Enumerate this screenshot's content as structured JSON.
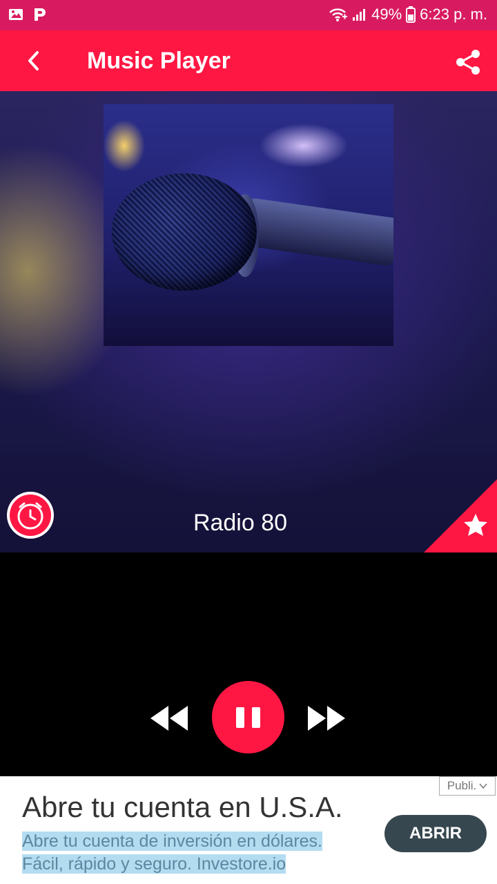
{
  "status_bar": {
    "battery": "49%",
    "time": "6:23 p. m."
  },
  "app_bar": {
    "title": "Music Player"
  },
  "player": {
    "station_name": "Radio 80"
  },
  "ad": {
    "badge": "Publi.",
    "headline": "Abre tu cuenta en U.S.A.",
    "body_line1": "Abre tu cuenta de inversión en dólares.",
    "body_line2": "Fácil, rápido y seguro. Investore.io",
    "cta": "ABRIR"
  },
  "colors": {
    "status_bar": "#d81b60",
    "accent": "#ff1744",
    "ad_button": "#37474f"
  }
}
